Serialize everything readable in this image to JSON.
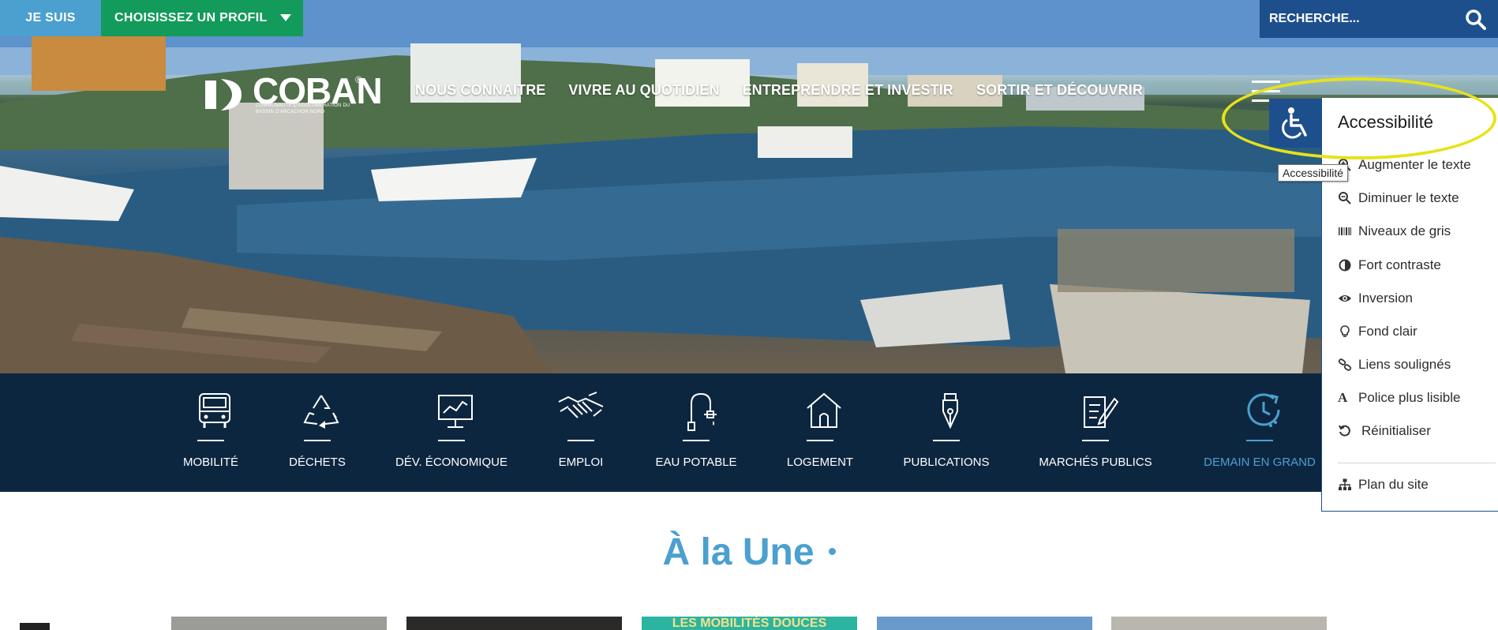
{
  "topbar": {
    "jesuis_label": "JE SUIS",
    "profil_label": "CHOISISSEZ UN PROFIL",
    "search_placeholder": "RECHERCHE..."
  },
  "logo": {
    "name": "COBAN",
    "registered": "®",
    "subtitle": "COMMUNAUTÉ D'AGGLOMÉRATION DU BASSIN D'ARCACHON NORD"
  },
  "nav": {
    "items": [
      "NOUS CONNAITRE",
      "VIVRE AU QUOTIDIEN",
      "ENTREPRENDRE ET INVESTIR",
      "SORTIR ET DÉCOUVRIR"
    ]
  },
  "quick_access": {
    "items": [
      {
        "label": "MOBILITÉ",
        "icon": "bus-icon"
      },
      {
        "label": "DÉCHETS",
        "icon": "recycle-icon"
      },
      {
        "label": "DÉV. ÉCONOMIQUE",
        "icon": "chart-board-icon"
      },
      {
        "label": "EMPLOI",
        "icon": "handshake-icon"
      },
      {
        "label": "EAU POTABLE",
        "icon": "water-tap-icon"
      },
      {
        "label": "LOGEMENT",
        "icon": "house-icon"
      },
      {
        "label": "PUBLICATIONS",
        "icon": "pen-nib-icon"
      },
      {
        "label": "MARCHÉS PUBLICS",
        "icon": "document-pen-icon"
      },
      {
        "label": "DEMAIN EN GRAND",
        "icon": "clock-icon",
        "active": true
      }
    ],
    "active_color": "#4ba0cf"
  },
  "une": {
    "title": "À la Une",
    "card_banner": "LES MOBILITÉS DOUCES"
  },
  "accessibility": {
    "title": "Accessibilité",
    "tooltip": "Accessibilité",
    "items": [
      {
        "label": "Augmenter le texte",
        "icon": "zoom-in-icon"
      },
      {
        "label": "Diminuer le texte",
        "icon": "zoom-out-icon"
      },
      {
        "label": "Niveaux de gris",
        "icon": "barcode-icon"
      },
      {
        "label": "Fort contraste",
        "icon": "contrast-icon"
      },
      {
        "label": "Inversion",
        "icon": "eye-icon"
      },
      {
        "label": "Fond clair",
        "icon": "lightbulb-icon"
      },
      {
        "label": "Liens soulignés",
        "icon": "link-icon"
      },
      {
        "label": "Police plus lisible",
        "icon": "font-icon"
      },
      {
        "label": "Réinitialiser",
        "icon": "reset-icon"
      }
    ],
    "sitemap_label": "Plan du site",
    "panel_color": "#1d4f8c",
    "highlight_color": "#e6e21a"
  }
}
